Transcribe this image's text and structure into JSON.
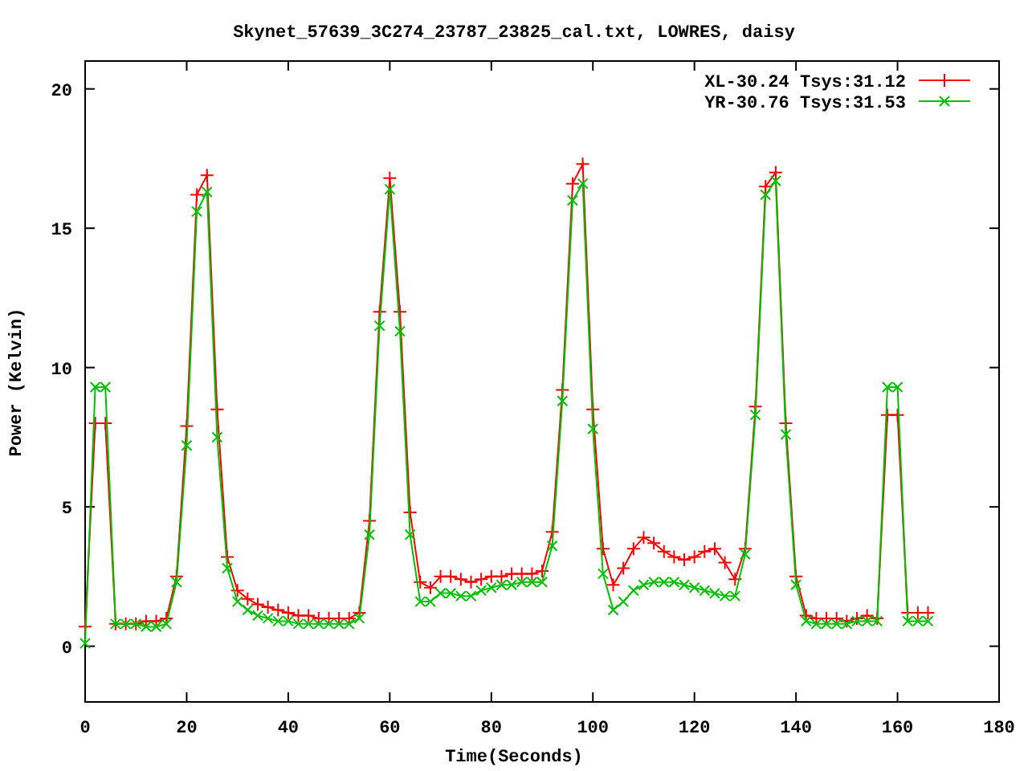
{
  "chart_data": {
    "type": "line",
    "title": "Skynet_57639_3C274_23787_23825_cal.txt, LOWRES, daisy",
    "xlabel": "Time(Seconds)",
    "ylabel": "Power (Kelvin)",
    "x": [
      0,
      2,
      4,
      6,
      8,
      10,
      12,
      14,
      16,
      18,
      20,
      22,
      24,
      26,
      28,
      30,
      32,
      34,
      36,
      38,
      40,
      42,
      44,
      46,
      48,
      50,
      52,
      54,
      56,
      58,
      60,
      62,
      64,
      66,
      68,
      70,
      72,
      74,
      76,
      78,
      80,
      82,
      84,
      86,
      88,
      90,
      92,
      94,
      96,
      98,
      100,
      102,
      104,
      106,
      108,
      110,
      112,
      114,
      116,
      118,
      120,
      122,
      124,
      126,
      128,
      130,
      132,
      134,
      136,
      138,
      140,
      142,
      144,
      146,
      148,
      150,
      152,
      154,
      156,
      158,
      160,
      162,
      164,
      166
    ],
    "series": [
      {
        "name": "XL-30.24 Tsys:31.12",
        "color": "#ff0000",
        "marker": "plus",
        "values": [
          0.7,
          8.0,
          8.0,
          0.8,
          0.8,
          0.8,
          0.9,
          0.9,
          1.0,
          2.5,
          7.9,
          16.2,
          16.9,
          8.5,
          3.2,
          2.0,
          1.7,
          1.5,
          1.4,
          1.3,
          1.2,
          1.1,
          1.1,
          1.0,
          1.0,
          1.0,
          1.0,
          1.2,
          4.5,
          12.0,
          16.8,
          12.0,
          4.8,
          2.3,
          2.1,
          2.5,
          2.5,
          2.4,
          2.3,
          2.4,
          2.5,
          2.5,
          2.6,
          2.6,
          2.6,
          2.7,
          4.1,
          9.2,
          16.6,
          17.3,
          8.5,
          3.5,
          2.2,
          2.8,
          3.5,
          3.9,
          3.7,
          3.4,
          3.2,
          3.1,
          3.2,
          3.4,
          3.5,
          3.0,
          2.4,
          3.5,
          8.6,
          16.5,
          17.0,
          8.0,
          2.5,
          1.1,
          1.0,
          1.0,
          1.0,
          0.9,
          1.0,
          1.1,
          1.0,
          8.3,
          8.3,
          1.2,
          1.2,
          1.2
        ]
      },
      {
        "name": "YR-30.76 Tsys:31.53",
        "color": "#00c000",
        "marker": "cross",
        "values": [
          0.1,
          9.3,
          9.3,
          0.8,
          0.8,
          0.8,
          0.7,
          0.7,
          0.8,
          2.3,
          7.2,
          15.6,
          16.3,
          7.5,
          2.8,
          1.6,
          1.3,
          1.1,
          1.0,
          0.9,
          0.9,
          0.8,
          0.8,
          0.8,
          0.8,
          0.8,
          0.8,
          1.0,
          4.0,
          11.5,
          16.4,
          11.3,
          4.0,
          1.6,
          1.6,
          1.9,
          1.9,
          1.8,
          1.8,
          2.0,
          2.1,
          2.2,
          2.2,
          2.3,
          2.3,
          2.3,
          3.6,
          8.8,
          16.0,
          16.6,
          7.8,
          2.6,
          1.3,
          1.6,
          2.0,
          2.2,
          2.3,
          2.3,
          2.3,
          2.2,
          2.1,
          2.0,
          1.9,
          1.8,
          1.8,
          3.3,
          8.3,
          16.2,
          16.7,
          7.6,
          2.2,
          0.9,
          0.8,
          0.8,
          0.8,
          0.8,
          0.9,
          0.9,
          0.9,
          9.3,
          9.3,
          0.9,
          0.9,
          0.9
        ]
      }
    ],
    "legend": true,
    "xlim": [
      0,
      180
    ],
    "ylim": [
      -2,
      21
    ],
    "xticks": [
      0,
      20,
      40,
      60,
      80,
      100,
      120,
      140,
      160,
      180
    ],
    "yticks": [
      0,
      5,
      10,
      15,
      20
    ]
  }
}
